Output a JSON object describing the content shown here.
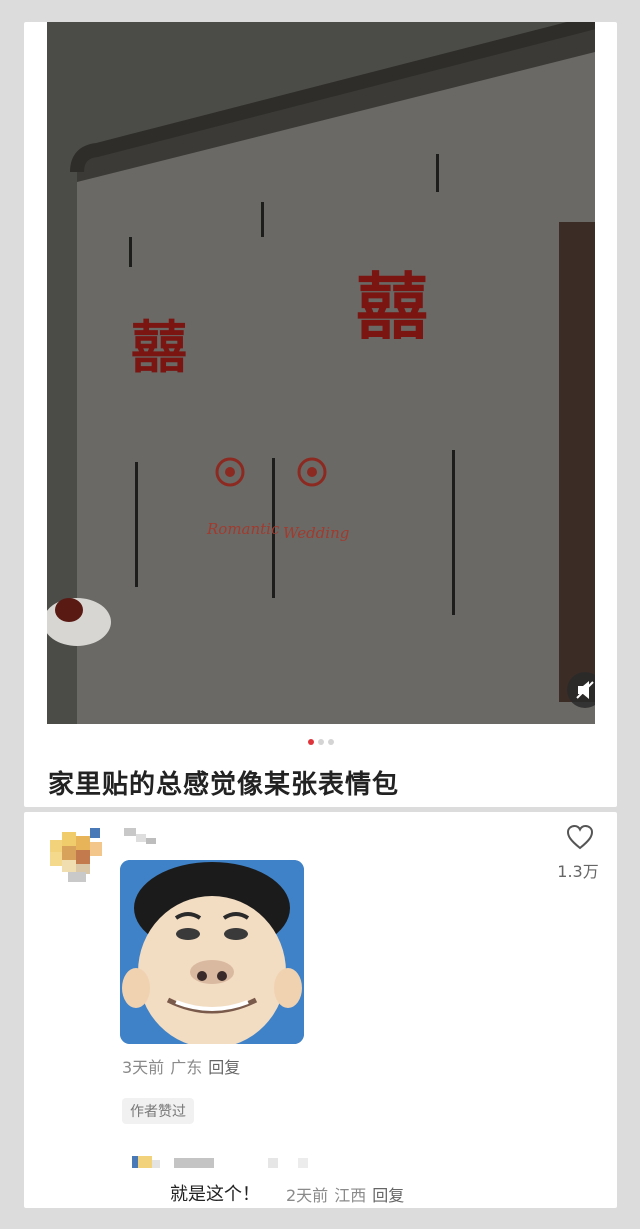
{
  "post": {
    "title": "家里贴的总感觉像某张表情包",
    "photo_decor_text_1": "Romantic",
    "photo_decor_text_2": "Wedding",
    "photo_xi_char": "囍",
    "carousel_count": 3,
    "carousel_active": 1
  },
  "comment": {
    "like_count": "1.3万",
    "time": "3天前",
    "location": "广东",
    "reply_label": "回复",
    "author_badge": "作者赞过"
  },
  "sub_reply": {
    "text": "就是这个！",
    "time": "2天前",
    "location": "江西",
    "reply_label": "回复"
  },
  "colors": {
    "accent_red": "#e0343c",
    "meta_gray": "#8a8a8a"
  },
  "icons": {
    "like": "heart-outline-icon",
    "mute": "speaker-mute-icon"
  }
}
